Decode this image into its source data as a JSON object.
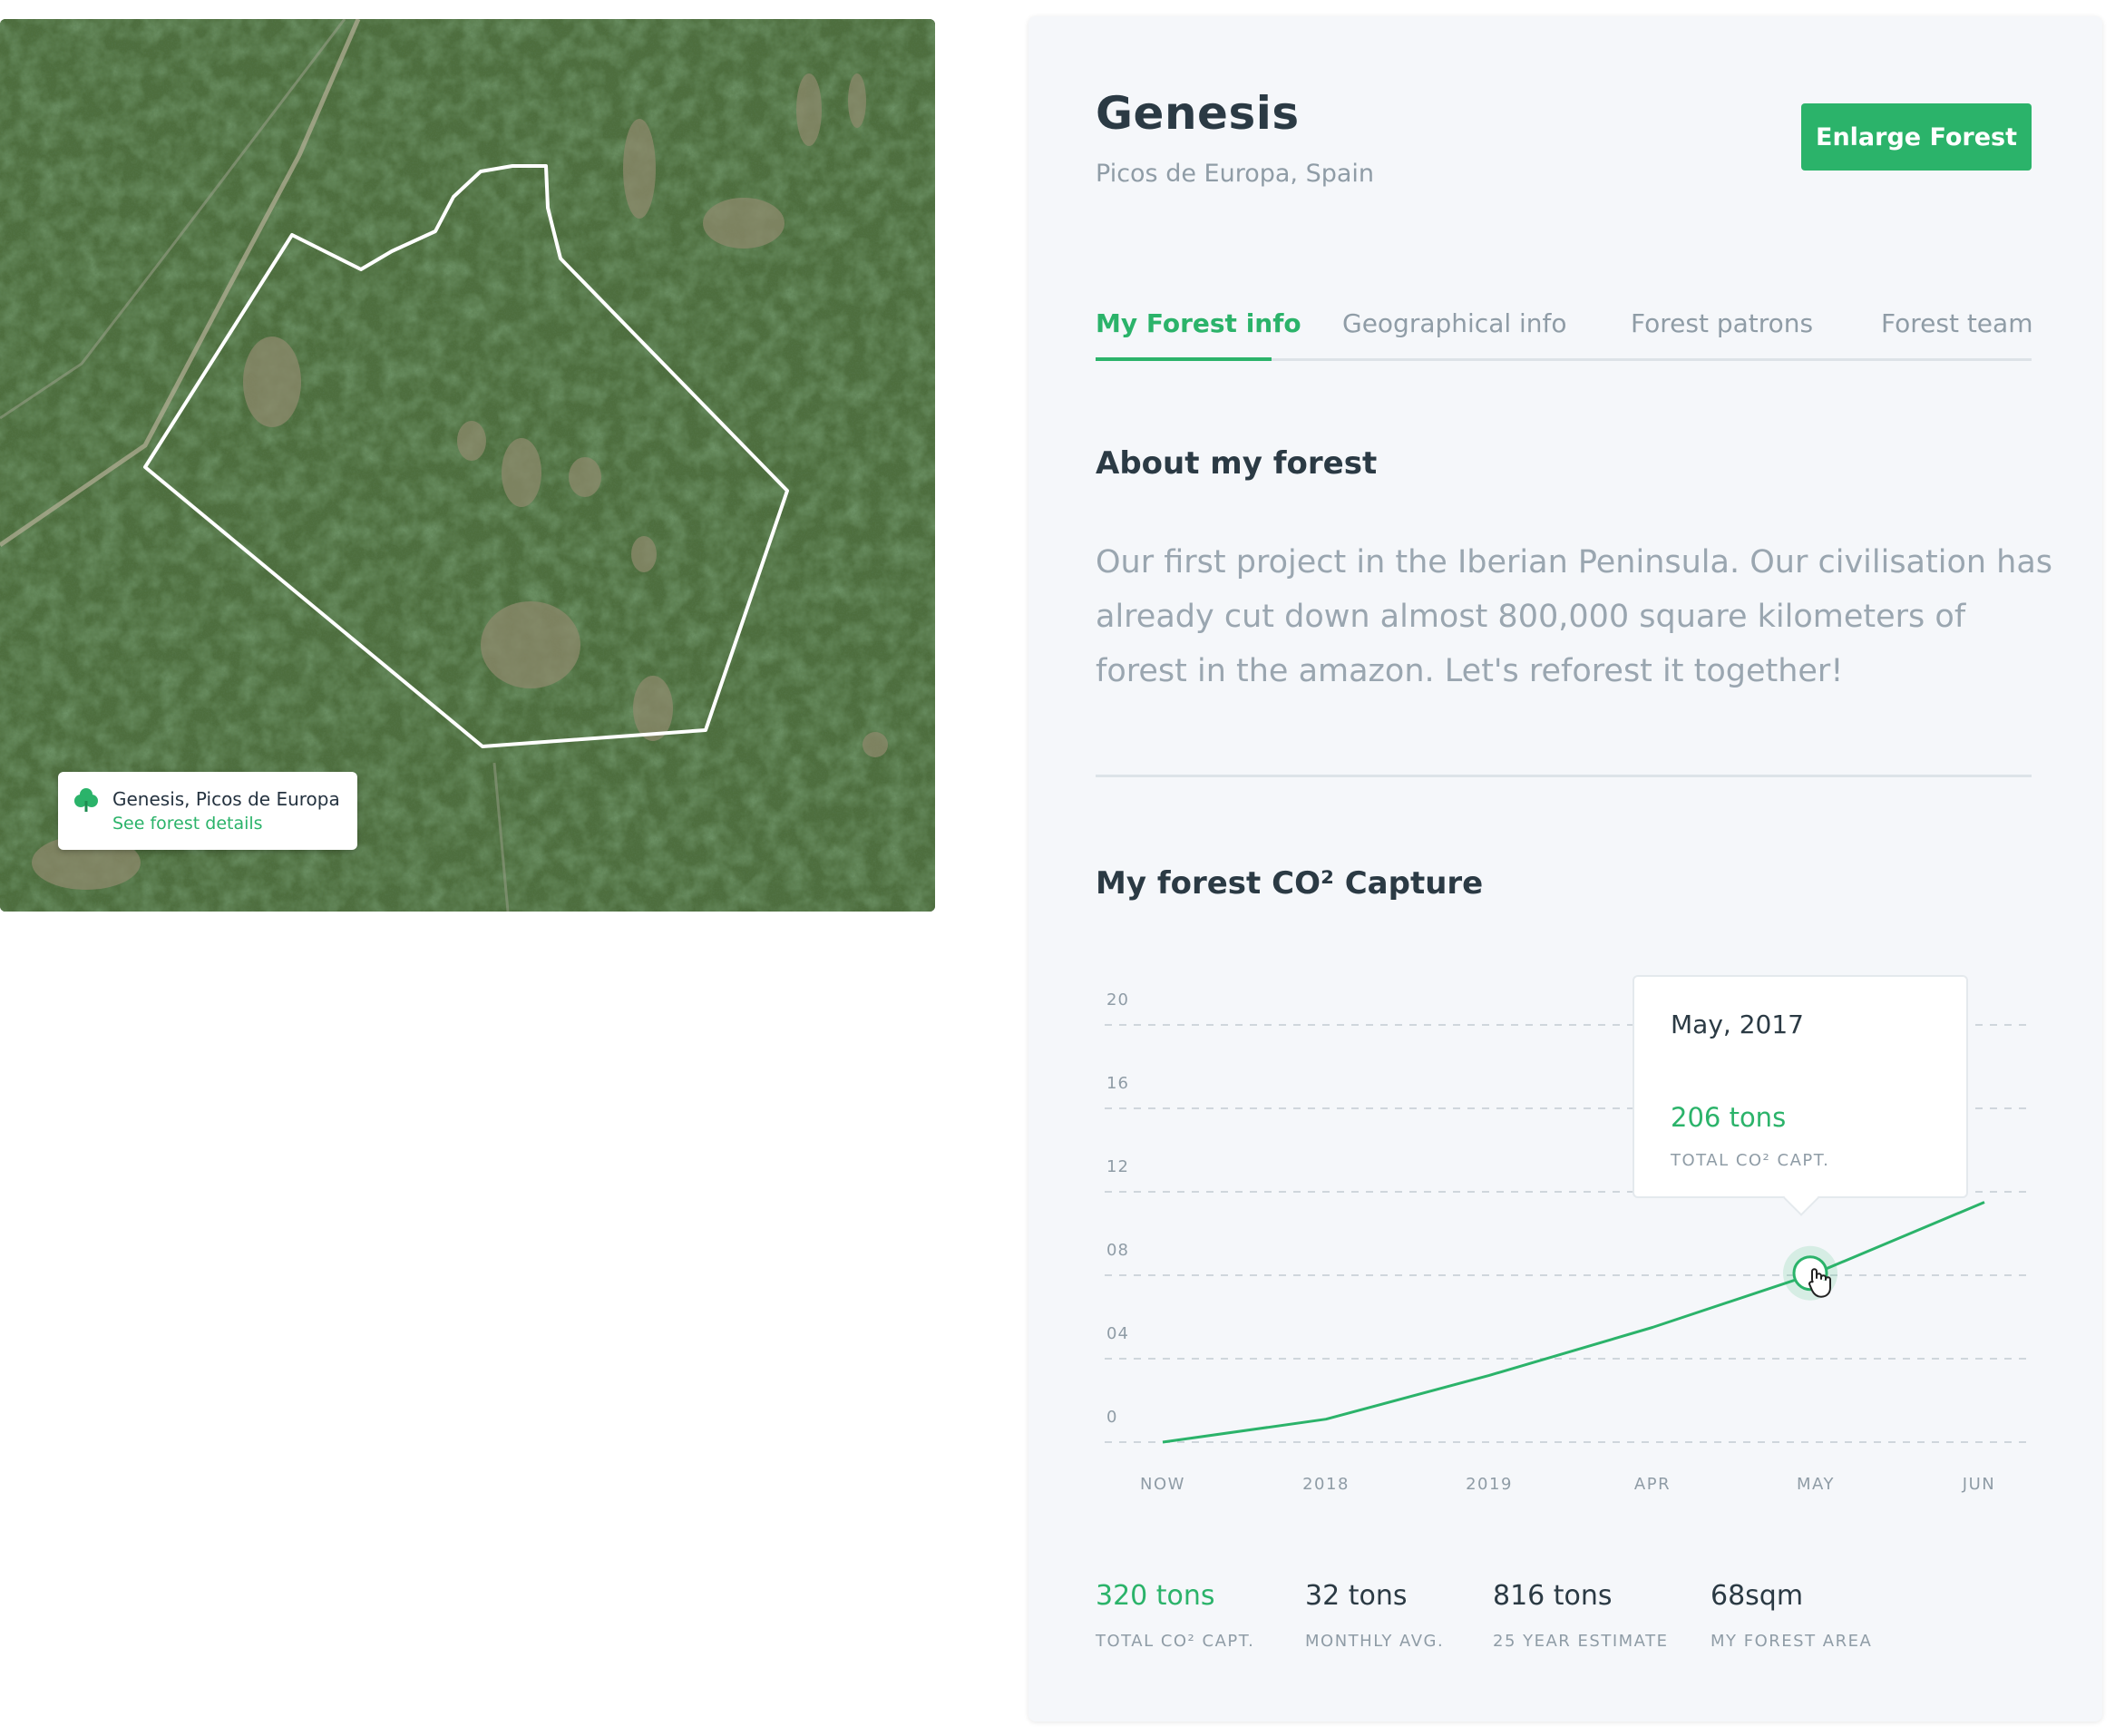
{
  "map": {
    "card_title": "Genesis, Picos de Europa",
    "card_link": "See forest details",
    "card_icon": "tree-icon"
  },
  "forest": {
    "title": "Genesis",
    "location": "Picos de Europa, Spain",
    "enlarge_label": "Enlarge Forest"
  },
  "tabs": [
    {
      "label": "My Forest info",
      "active": true
    },
    {
      "label": "Geographical info",
      "active": false
    },
    {
      "label": "Forest patrons",
      "active": false
    },
    {
      "label": "Forest team",
      "active": false
    }
  ],
  "about": {
    "heading": "About my forest",
    "text": "Our first project in the Iberian Peninsula. Our civilisation has already cut down almost 800,000 square kilometers of forest in the amazon. Let's reforest it together!"
  },
  "co2": {
    "heading": "My forest CO² Capture"
  },
  "chart_data": {
    "type": "line",
    "title": "",
    "xlabel": "",
    "ylabel": "",
    "categories": [
      "NOW",
      "2018",
      "2019",
      "APR",
      "MAY",
      "JUN"
    ],
    "y_tick_labels": [
      "0",
      "04",
      "08",
      "12",
      "16",
      "20"
    ],
    "ylim": [
      0,
      20
    ],
    "grid": true,
    "series": [
      {
        "values": [
          0,
          1.1,
          3.2,
          5.5,
          8.1,
          11.5
        ],
        "color": "#2bb36a"
      }
    ],
    "highlight": {
      "index": 4,
      "value": 8.1
    }
  },
  "tooltip": {
    "date": "May, 2017",
    "value": "206 tons",
    "label": "TOTAL CO² CAPT."
  },
  "stats": [
    {
      "value": "320 tons",
      "label": "TOTAL CO² CAPT.",
      "highlight": true
    },
    {
      "value": "32 tons",
      "label": "MONTHLY AVG.",
      "highlight": false
    },
    {
      "value": "816 tons",
      "label": "25 YEAR ESTIMATE",
      "highlight": false
    },
    {
      "value": "68sqm",
      "label": "MY FOREST AREA",
      "highlight": false
    }
  ],
  "colors": {
    "accent": "#2bb36a",
    "text_dark": "#2b3a44",
    "text_muted": "#8f9ca6",
    "panel_bg": "#f5f7fa"
  }
}
